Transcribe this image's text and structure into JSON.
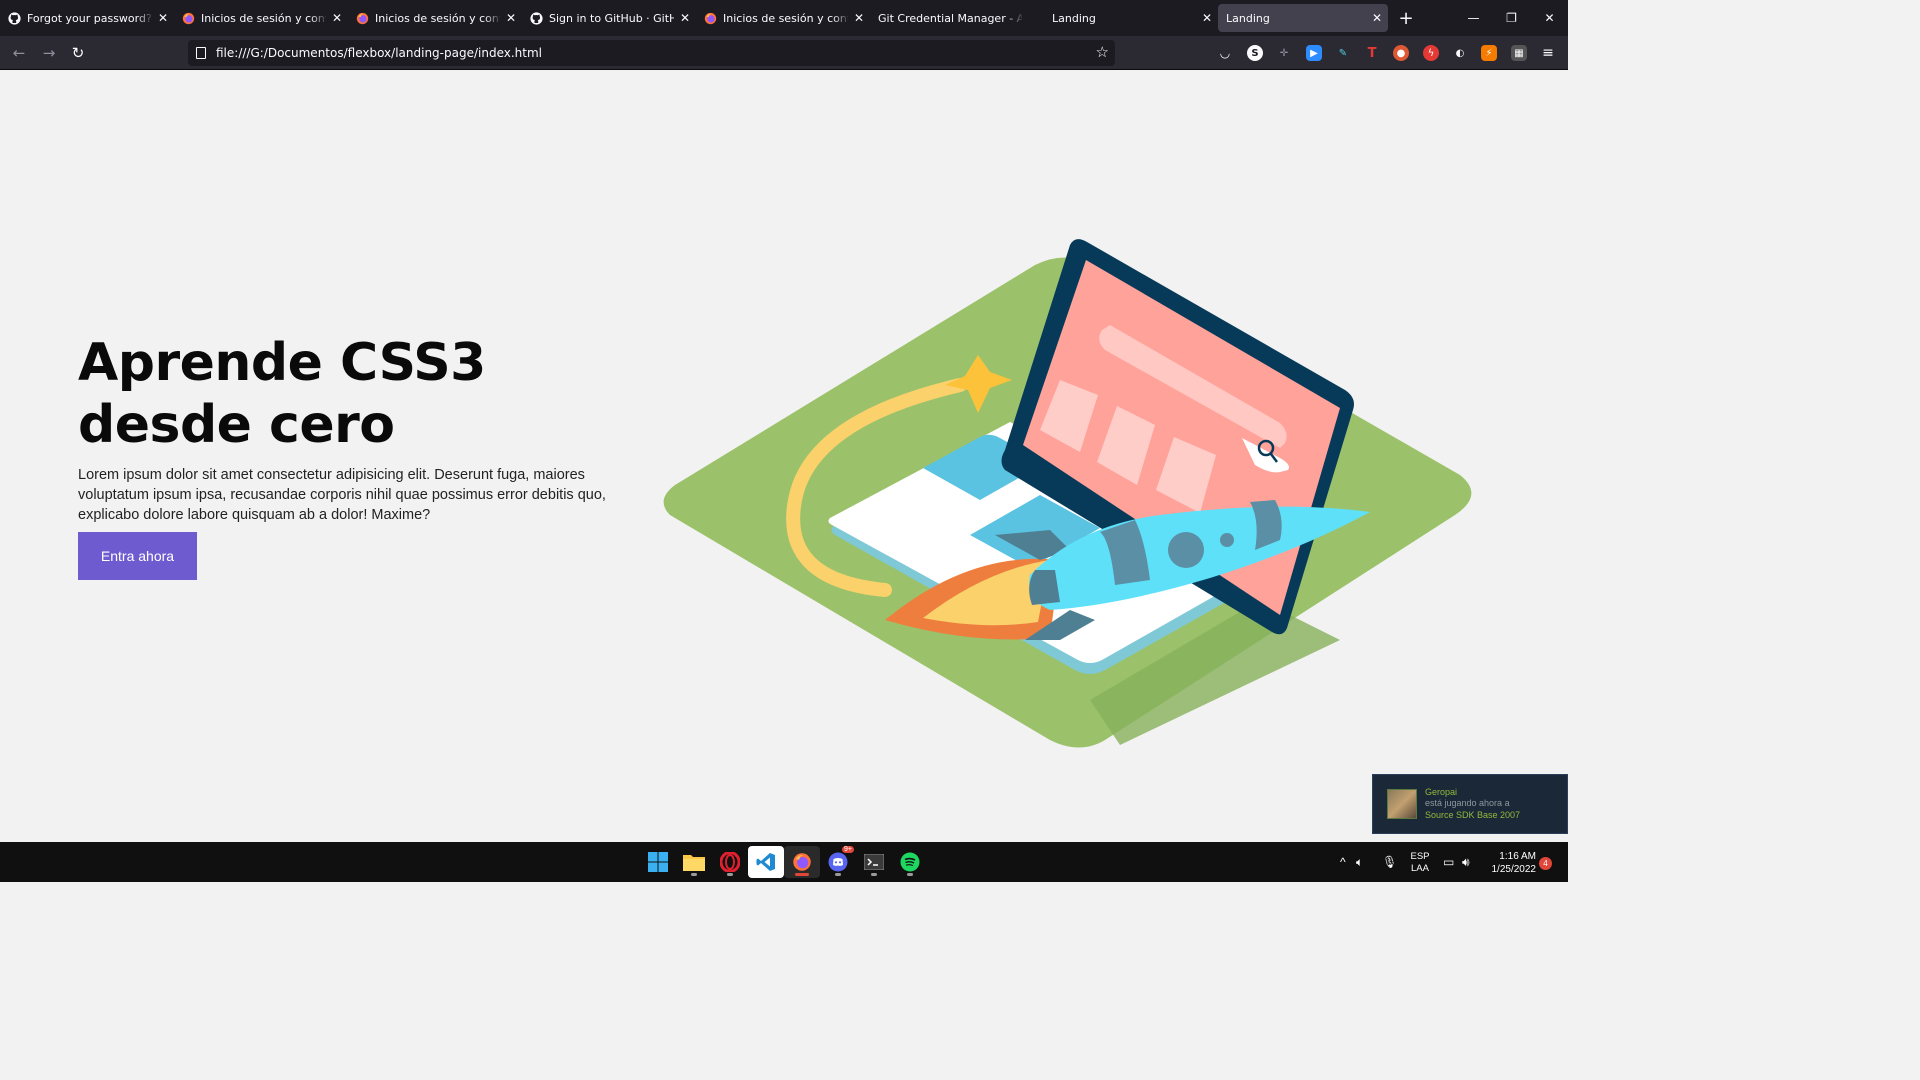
{
  "browser": {
    "tabs": [
      {
        "title": "Forgot your password? · GitHub",
        "icon": "github-icon",
        "active": false
      },
      {
        "title": "Inicios de sesión y contraseñas",
        "icon": "firefox-icon",
        "active": false
      },
      {
        "title": "Inicios de sesión y contraseñas",
        "icon": "firefox-icon",
        "active": false
      },
      {
        "title": "Sign in to GitHub · GitHub",
        "icon": "github-icon",
        "active": false
      },
      {
        "title": "Inicios de sesión y contraseñas",
        "icon": "firefox-icon",
        "active": false
      },
      {
        "title": "Git Credential Manager - Authentication",
        "icon": "none",
        "active": false
      },
      {
        "title": "Landing",
        "icon": "none",
        "active": false
      },
      {
        "title": "Landing",
        "icon": "none",
        "active": true
      }
    ],
    "url": "file:///G:/Documentos/flexbox/landing-page/index.html"
  },
  "hero": {
    "title": "Aprende CSS3 desde cero",
    "text": "Lorem ipsum dolor sit amet consectetur adipisicing elit. Deserunt fuga, maiores voluptatum ipsum ipsa, recusandae corporis nihil quae possimus error debitis quo, explicabo dolore labore quisquam ab a dolor! Maxime?",
    "cta": "Entra ahora",
    "cta_color": "#6f5bd0"
  },
  "toast": {
    "name": "Geropai",
    "status": "está jugando ahora a",
    "game": "Source SDK Base 2007"
  },
  "taskbar": {
    "lang_1": "ESP",
    "lang_2": "LAA",
    "time": "1:16 AM",
    "date": "1/25/2022",
    "notifications": "4",
    "discord_badge": "9+"
  }
}
